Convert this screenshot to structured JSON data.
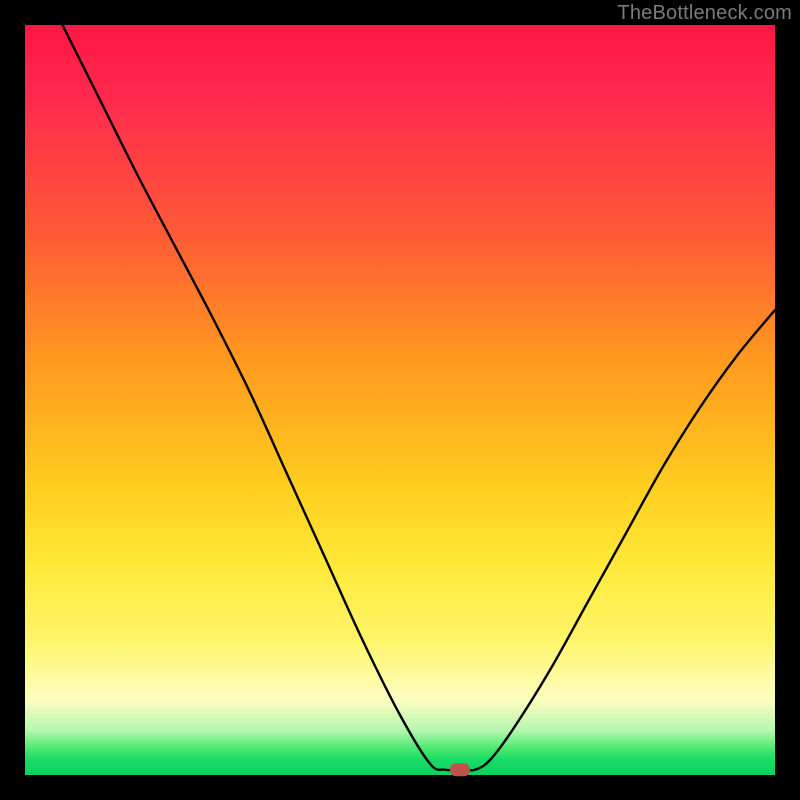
{
  "watermark": "TheBottleneck.com",
  "chart_data": {
    "type": "line",
    "title": "",
    "xlabel": "",
    "ylabel": "",
    "xlim": [
      0,
      100
    ],
    "ylim": [
      0,
      100
    ],
    "series": [
      {
        "name": "bottleneck-curve",
        "x": [
          5,
          10,
          15,
          20,
          25,
          30,
          35,
          40,
          45,
          50,
          54,
          56,
          58,
          60,
          62,
          65,
          70,
          75,
          80,
          85,
          90,
          95,
          100
        ],
        "values": [
          100,
          90,
          80,
          70.5,
          61,
          51,
          40,
          29,
          18,
          8,
          1.5,
          0.7,
          0.7,
          0.7,
          2,
          6,
          14,
          23,
          32,
          41,
          49,
          56,
          62
        ]
      }
    ],
    "marker": {
      "x": 58,
      "y": 0.7,
      "color": "#c1524a"
    }
  }
}
